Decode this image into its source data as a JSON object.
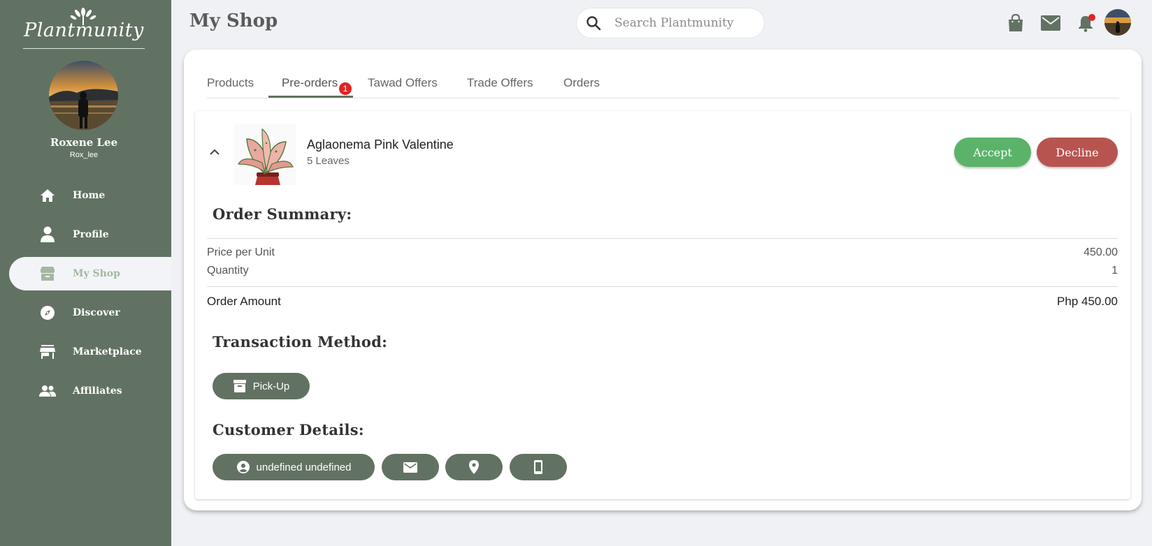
{
  "sidebar": {
    "logo_text": "Plantmunity",
    "user": {
      "name": "Roxene Lee",
      "handle": "Rox_lee"
    },
    "nav": [
      {
        "label": "Home",
        "icon": "home-icon"
      },
      {
        "label": "Profile",
        "icon": "person-icon"
      },
      {
        "label": "My Shop",
        "icon": "shop-icon",
        "active": true
      },
      {
        "label": "Discover",
        "icon": "compass-icon"
      },
      {
        "label": "Marketplace",
        "icon": "storefront-icon"
      },
      {
        "label": "Affiliates",
        "icon": "group-icon"
      }
    ]
  },
  "header": {
    "title": "My Shop",
    "search_placeholder": "Search Plantmunity",
    "icons": [
      "shopping-bag-icon",
      "mail-icon",
      "bell-icon"
    ]
  },
  "tabs": {
    "items": [
      "Products",
      "Pre-orders",
      "Tawad Offers",
      "Trade Offers",
      "Orders"
    ],
    "active": "Pre-orders",
    "badge": "1"
  },
  "order": {
    "product_name": "Aglaonema Pink Valentine",
    "product_sub": "5 Leaves",
    "accept_label": "Accept",
    "decline_label": "Decline",
    "summary_title": "Order Summary:",
    "price_label": "Price per Unit",
    "price_value": "450.00",
    "quantity_label": "Quantity",
    "quantity_value": "1",
    "amount_label": "Order Amount",
    "amount_value": "Php 450.00",
    "transaction_title": "Transaction Method:",
    "transaction_method": "Pick-Up",
    "customer_title": "Customer Details:",
    "customer_name": "undefined undefined"
  },
  "colors": {
    "sidebar": "#627262",
    "accept": "#5bb36a",
    "decline": "#b85450",
    "badge": "#e02424",
    "background": "#eff1f5"
  }
}
